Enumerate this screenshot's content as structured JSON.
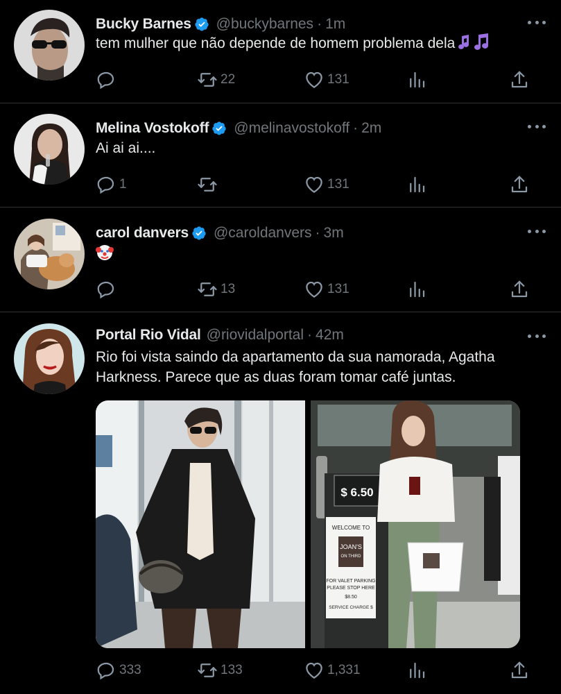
{
  "tweets": [
    {
      "name": "Bucky Barnes",
      "handle": "@buckybarnes",
      "separator": "·",
      "time": "1m",
      "text": "tem mulher que não depende de homem problema dela",
      "text_emoji": "musical-notes",
      "verified": true,
      "replies": "",
      "retweets": "22",
      "likes": "131"
    },
    {
      "name": "Melina Vostokoff",
      "handle": "@melinavostokoff",
      "separator": "·",
      "time": "2m",
      "text": "Ai ai ai....",
      "verified": true,
      "replies": "1",
      "retweets": "",
      "likes": "131"
    },
    {
      "name": "carol danvers",
      "handle": "@caroldanvers",
      "separator": "·",
      "time": "3m",
      "text": "",
      "text_emoji": "clown-face",
      "verified": true,
      "replies": "",
      "retweets": "13",
      "likes": "131"
    },
    {
      "name": "Portal Rio Vidal",
      "handle": "@riovidalportal",
      "separator": "·",
      "time": "42m",
      "text": "Rio foi vista saindo da apartamento da sua namorada, Agatha Harkness. Parece que as duas foram tomar café juntas.",
      "verified": false,
      "replies": "333",
      "retweets": "133",
      "likes": "1,331",
      "photo_right_texts": {
        "price": "$ 6.50",
        "welcome": "WELCOME TO",
        "brand_line1": "JOAN'S",
        "brand_line2": "ON THIRD",
        "valet_line1": "FOR VALET PARKING",
        "valet_line2": "PLEASE STOP HERE",
        "price_small": "$8.50",
        "service": "SERVICE CHARGE $"
      }
    }
  ],
  "colors": {
    "background": "#000000",
    "text": "#e7e9ea",
    "secondary": "#71767b",
    "verified": "#1d9bf0",
    "divider": "#2f3336"
  }
}
